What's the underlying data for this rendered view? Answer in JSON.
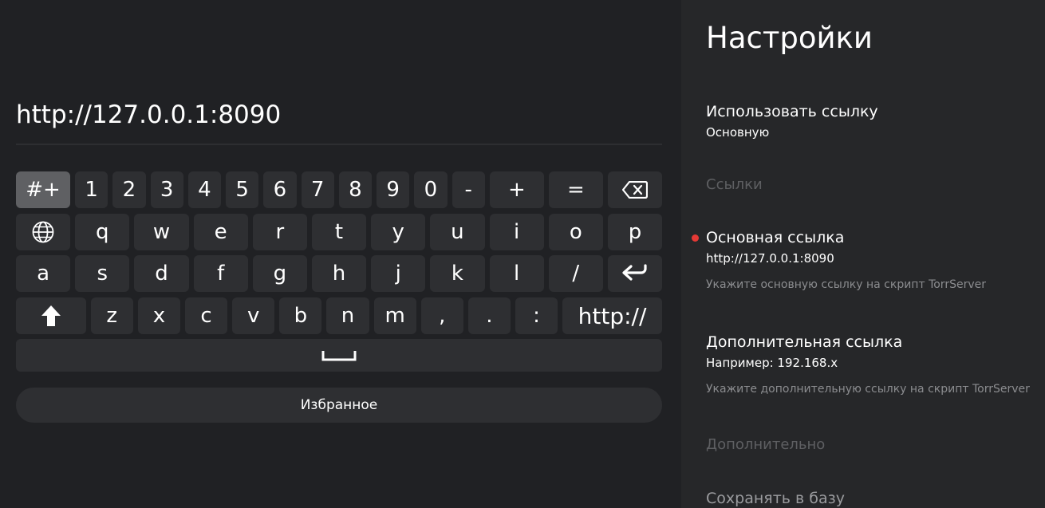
{
  "keyboard": {
    "input_value": "http://127.0.0.1:8090",
    "row1": [
      "#+",
      "1",
      "2",
      "3",
      "4",
      "5",
      "6",
      "7",
      "8",
      "9",
      "0",
      "-",
      "+",
      "="
    ],
    "row2": [
      "q",
      "w",
      "e",
      "r",
      "t",
      "y",
      "u",
      "i",
      "o",
      "p"
    ],
    "row3": [
      "a",
      "s",
      "d",
      "f",
      "g",
      "h",
      "j",
      "k",
      "l",
      "/"
    ],
    "row4": [
      "z",
      "x",
      "c",
      "v",
      "b",
      "n",
      "m",
      ",",
      ".",
      ":"
    ],
    "http_key": "http://",
    "icons": {
      "backspace": "backspace-icon",
      "language": "globe-icon",
      "enter": "enter-icon",
      "shift": "shift-icon",
      "space": "space-icon"
    },
    "favorites_label": "Избранное"
  },
  "settings": {
    "title": "Настройки",
    "use_link": {
      "name": "Использовать ссылку",
      "value": "Основную"
    },
    "links_section": "Ссылки",
    "main_link": {
      "name": "Основная ссылка",
      "value": "http://127.0.0.1:8090",
      "description": "Укажите основную ссылку на скрипт TorrServer"
    },
    "extra_link": {
      "name": "Дополнительная ссылка",
      "value": "Например: 192.168.x",
      "description": "Укажите дополнительную ссылку на скрипт TorrServer"
    },
    "more_section": "Дополнительно",
    "save_to_db": {
      "name": "Сохранять в базу"
    }
  },
  "colors": {
    "background": "#202124",
    "panel": "#262729",
    "key": "#2e2f32",
    "key_selected": "#5f6063",
    "focus_dot": "#e53935"
  }
}
